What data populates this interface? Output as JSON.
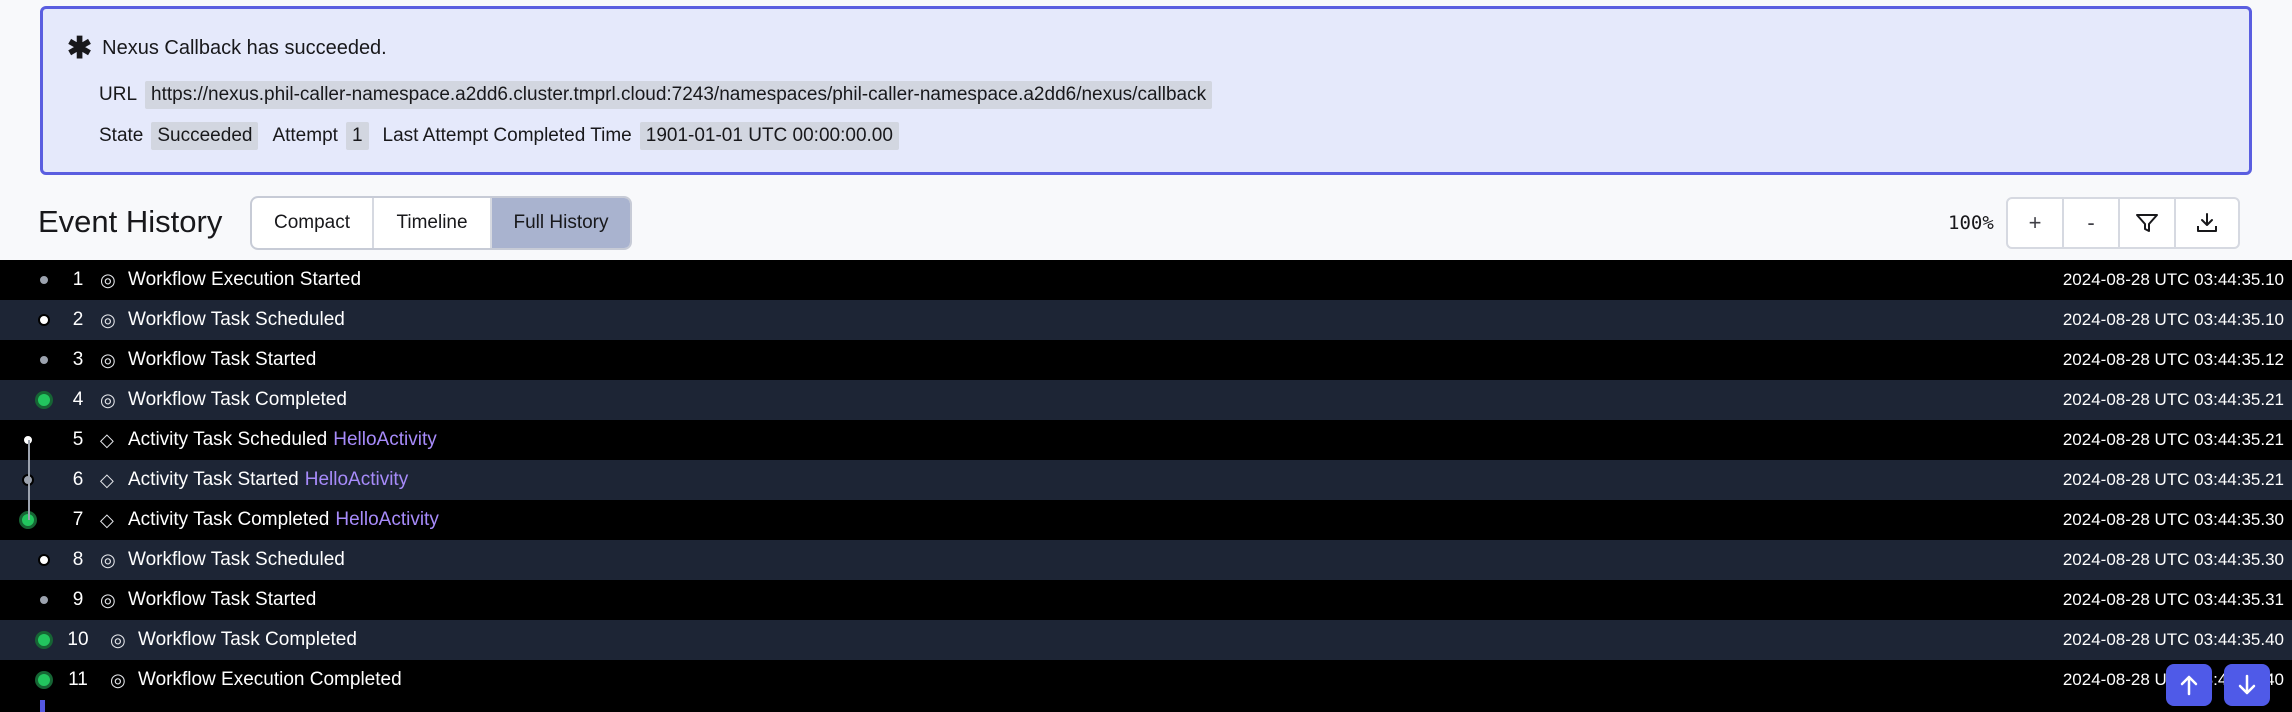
{
  "callback": {
    "title": "Nexus Callback has succeeded.",
    "url_label": "URL",
    "url": "https://nexus.phil-caller-namespace.a2dd6.cluster.tmprl.cloud:7243/namespaces/phil-caller-namespace.a2dd6/nexus/callback",
    "state_label": "State",
    "state": "Succeeded",
    "attempt_label": "Attempt",
    "attempt": "1",
    "last_label": "Last Attempt Completed Time",
    "last_time": "1901-01-01 UTC 00:00:00.00"
  },
  "header": {
    "title": "Event History",
    "views": [
      "Compact",
      "Timeline",
      "Full History"
    ],
    "selected_view": "Full History",
    "zoom": "100%",
    "zoom_in": "+",
    "zoom_out": "-"
  },
  "events": [
    {
      "id": "1",
      "name": "Workflow Execution Started",
      "activity": "",
      "time": "2024-08-28 UTC 03:44:35.10",
      "kind": "workflow"
    },
    {
      "id": "2",
      "name": "Workflow Task Scheduled",
      "activity": "",
      "time": "2024-08-28 UTC 03:44:35.10",
      "kind": "workflow"
    },
    {
      "id": "3",
      "name": "Workflow Task Started",
      "activity": "",
      "time": "2024-08-28 UTC 03:44:35.12",
      "kind": "workflow"
    },
    {
      "id": "4",
      "name": "Workflow Task Completed",
      "activity": "",
      "time": "2024-08-28 UTC 03:44:35.21",
      "kind": "workflow"
    },
    {
      "id": "5",
      "name": "Activity Task Scheduled",
      "activity": "HelloActivity",
      "time": "2024-08-28 UTC 03:44:35.21",
      "kind": "activity"
    },
    {
      "id": "6",
      "name": "Activity Task Started",
      "activity": "HelloActivity",
      "time": "2024-08-28 UTC 03:44:35.21",
      "kind": "activity"
    },
    {
      "id": "7",
      "name": "Activity Task Completed",
      "activity": "HelloActivity",
      "time": "2024-08-28 UTC 03:44:35.30",
      "kind": "activity"
    },
    {
      "id": "8",
      "name": "Workflow Task Scheduled",
      "activity": "",
      "time": "2024-08-28 UTC 03:44:35.30",
      "kind": "workflow"
    },
    {
      "id": "9",
      "name": "Workflow Task Started",
      "activity": "",
      "time": "2024-08-28 UTC 03:44:35.31",
      "kind": "workflow"
    },
    {
      "id": "10",
      "name": "Workflow Task Completed",
      "activity": "",
      "time": "2024-08-28 UTC 03:44:35.40",
      "kind": "workflow"
    },
    {
      "id": "11",
      "name": "Workflow Execution Completed",
      "activity": "",
      "time": "2024-08-28 UTC 03:44:35.40",
      "kind": "workflow"
    }
  ],
  "colors": {
    "accent": "#5a5ee0",
    "success": "#22c55e",
    "activity_link": "#a78bfa"
  },
  "icons": {
    "workflow": "eye-icon",
    "activity": "diamond-icon",
    "scroll_up": "arrow-up-icon",
    "scroll_down": "arrow-down-icon",
    "filter": "filter-icon",
    "download": "download-icon"
  }
}
